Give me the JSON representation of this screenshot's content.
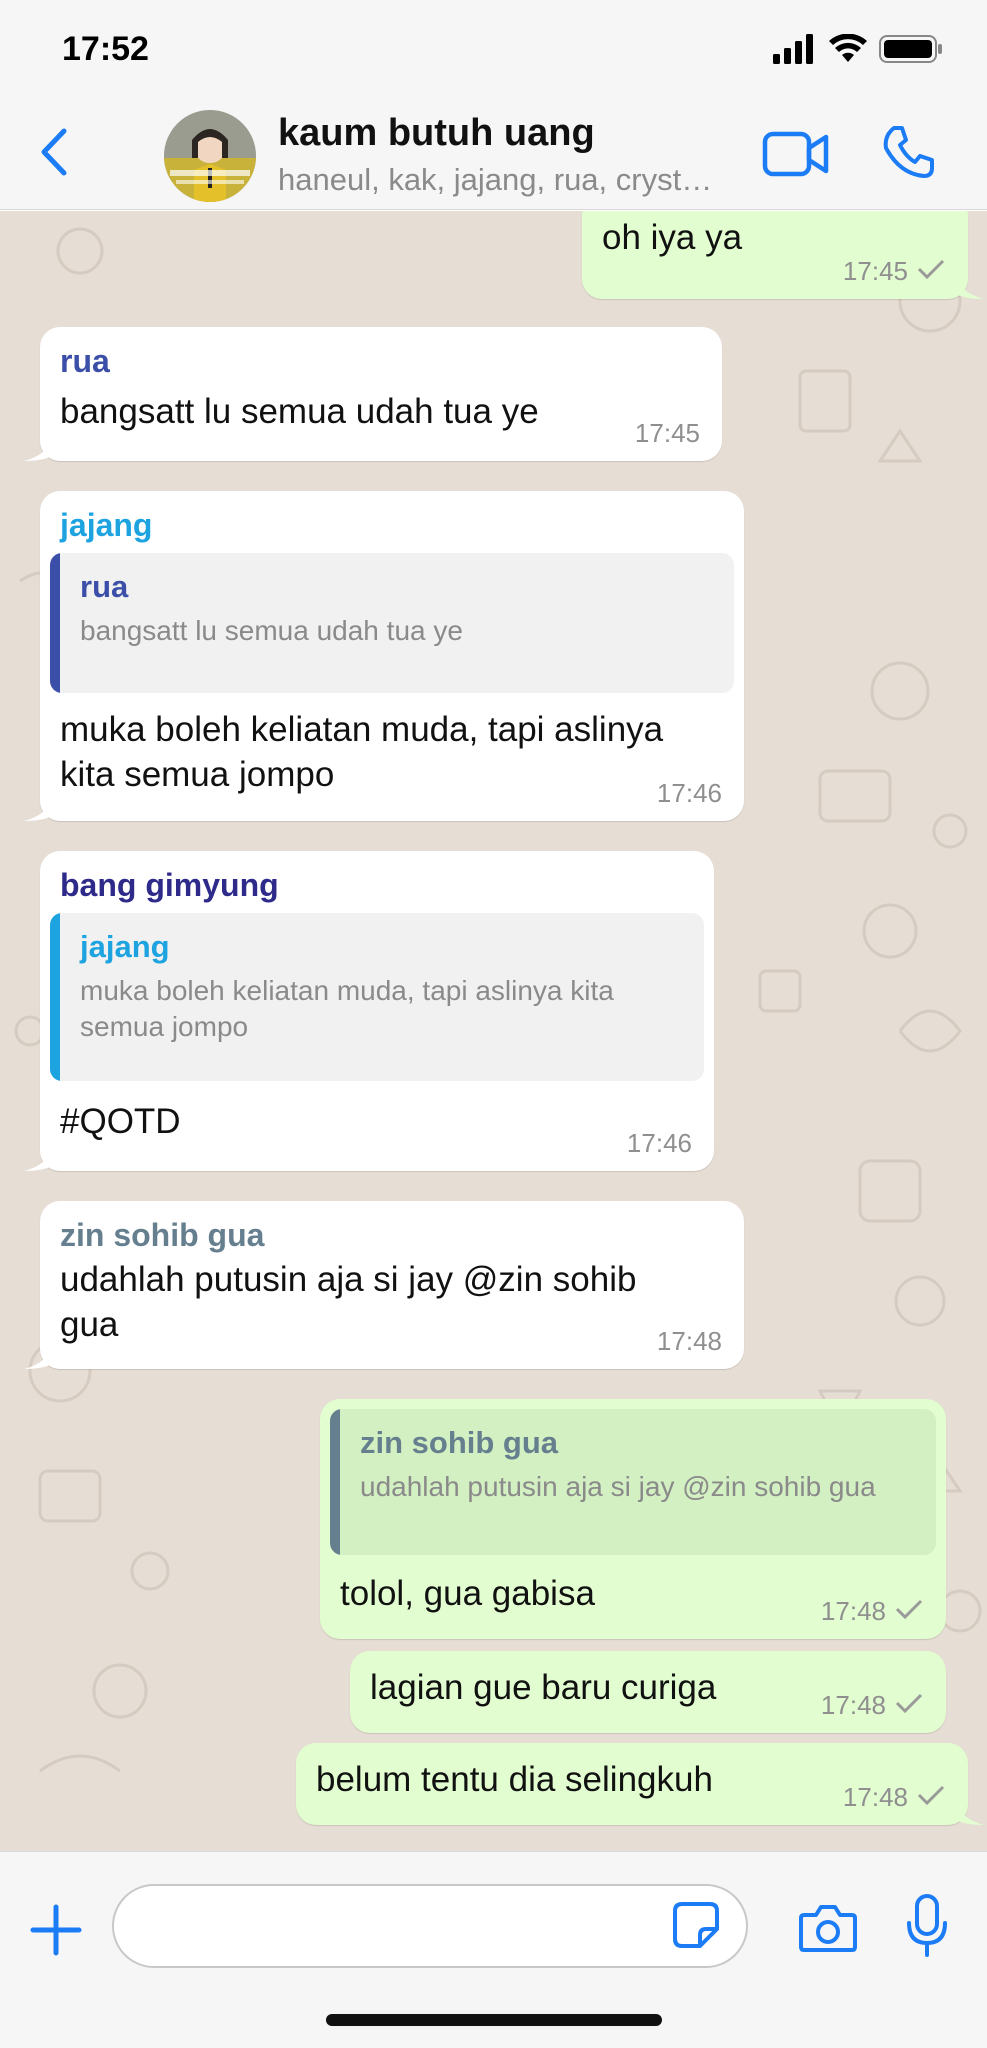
{
  "status_bar": {
    "time": "17:52"
  },
  "header": {
    "group_name": "kaum butuh uang",
    "members": "haneul, kak, jajang, rua, crystal, zin sohib gua, bang gimyung",
    "icons": [
      "chevron-left-icon",
      "video-camera-icon",
      "phone-icon"
    ]
  },
  "colors": {
    "accent": "#1b7cf5",
    "chat_bg": "#e6ddd4",
    "outgoing_bubble": "#e2fdd0",
    "incoming_bubble": "#ffffff",
    "sender_rua": "#3b4fa8",
    "sender_jajang": "#1da3e0",
    "sender_gimyung": "#2d2a8a",
    "sender_zin": "#667f8f"
  },
  "messages": [
    {
      "direction": "out",
      "text": "oh iya ya",
      "time": "17:45"
    },
    {
      "direction": "in",
      "sender": "rua",
      "text": "bangsatt lu semua udah tua ye",
      "time": "17:45"
    },
    {
      "direction": "in",
      "sender": "jajang",
      "quote_sender": "rua",
      "quote_text": "bangsatt lu semua udah tua ye",
      "text": "muka boleh keliatan muda, tapi aslinya kita semua jompo",
      "time": "17:46"
    },
    {
      "direction": "in",
      "sender": "bang gimyung",
      "quote_sender": "jajang",
      "quote_text": "muka boleh keliatan muda, tapi aslinya kita semua jompo",
      "text": "#QOTD",
      "time": "17:46"
    },
    {
      "direction": "in",
      "sender": "zin sohib gua",
      "text": "udahlah putusin aja si jay @zin sohib gua",
      "time": "17:48"
    },
    {
      "direction": "out",
      "quote_sender": "zin sohib gua",
      "quote_text": "udahlah putusin aja si jay @zin sohib gua",
      "text": "tolol, gua gabisa",
      "time": "17:48"
    },
    {
      "direction": "out",
      "text": "lagian gue baru curiga",
      "time": "17:48"
    },
    {
      "direction": "out",
      "text": "belum tentu dia selingkuh",
      "time": "17:48"
    }
  ],
  "input": {
    "value": "",
    "icons": [
      "plus-icon",
      "sticker-icon",
      "camera-icon",
      "microphone-icon"
    ]
  }
}
